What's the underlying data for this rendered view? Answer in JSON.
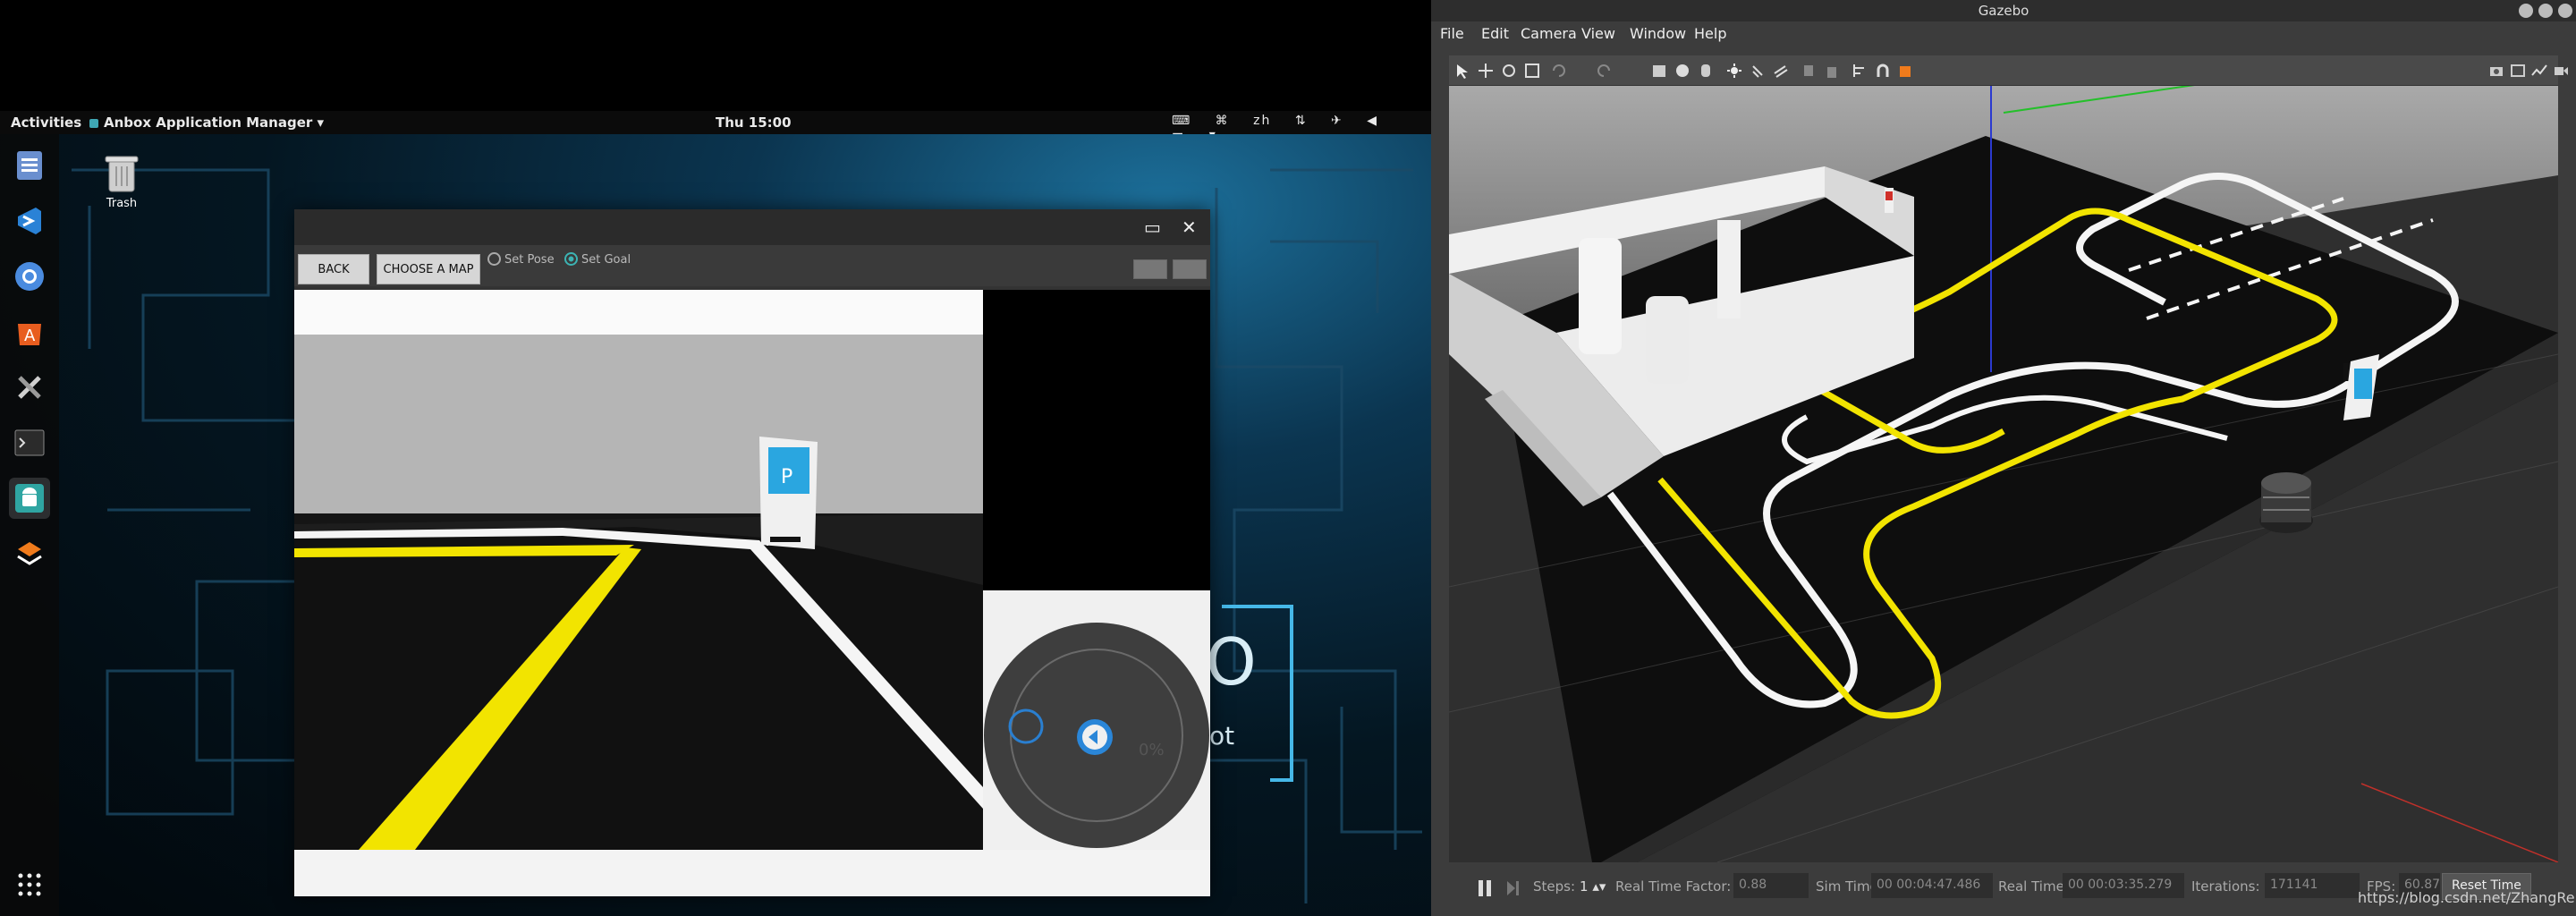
{
  "topbar": {
    "activities": "Activities",
    "app_name": "Anbox Application Manager",
    "clock": "Thu 15:00",
    "lang": "zh"
  },
  "desktop": {
    "trash_label": "Trash"
  },
  "anbox": {
    "back": "BACK",
    "choose_map": "CHOOSE A MAP",
    "set_pose": "Set Pose",
    "set_goal": "Set Goal",
    "progress_text": "0%",
    "sign_text": "P"
  },
  "wallpaper": {
    "logo_text": "O",
    "logo_sub": "ot"
  },
  "gazebo": {
    "title": "Gazebo",
    "menu": [
      "File",
      "Edit",
      "Camera",
      "View",
      "Window",
      "Help"
    ],
    "status": {
      "steps_label": "Steps:",
      "steps_value": "1",
      "rtf_label": "Real Time Factor:",
      "rtf_value": "0.88",
      "sim_time_label": "Sim Time:",
      "sim_time_value": "00 00:04:47.486",
      "real_time_label": "Real Time:",
      "real_time_value": "00 00:03:35.279",
      "iterations_label": "Iterations:",
      "iterations_value": "171141",
      "fps_label": "FPS:",
      "fps_value": "60.87",
      "reset_label": "Reset Time"
    }
  },
  "watermark": "https://blog.csdn.net/ZhangRelay",
  "colors": {
    "track_yellow": "#f2e400",
    "track_white": "#f5f5f5",
    "anbox_accent": "#3cb4b4"
  }
}
